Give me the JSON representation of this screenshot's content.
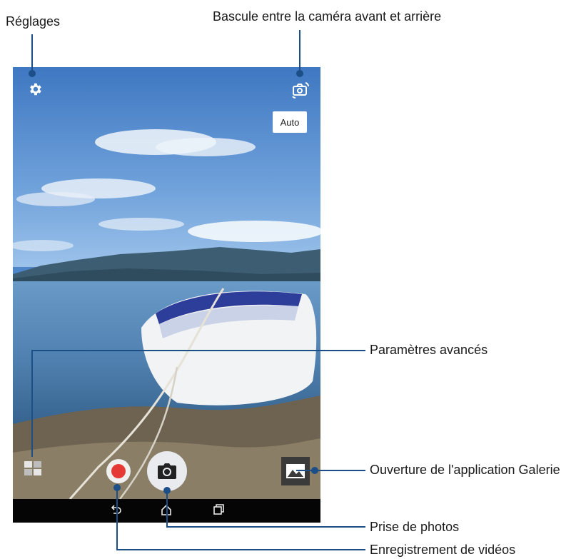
{
  "callouts": {
    "settings": "Réglages",
    "switch_camera": "Bascule entre la caméra avant et arrière",
    "advanced_settings": "Paramètres avancés",
    "gallery": "Ouverture de l'application Galerie",
    "take_photo": "Prise de photos",
    "record_video": "Enregistrement de vidéos"
  },
  "camera": {
    "mode_label": "Auto"
  },
  "icons": {
    "settings": "gear-icon",
    "switch_camera": "camera-switch-icon",
    "advanced": "advanced-settings-icon",
    "record": "record-icon",
    "shutter": "camera-icon",
    "gallery": "gallery-icon",
    "back": "back-icon",
    "home": "home-icon",
    "recents": "recents-icon"
  },
  "colors": {
    "callout_line": "#1c4e87",
    "record_red": "#e53935",
    "sky": "#4f86c9"
  }
}
